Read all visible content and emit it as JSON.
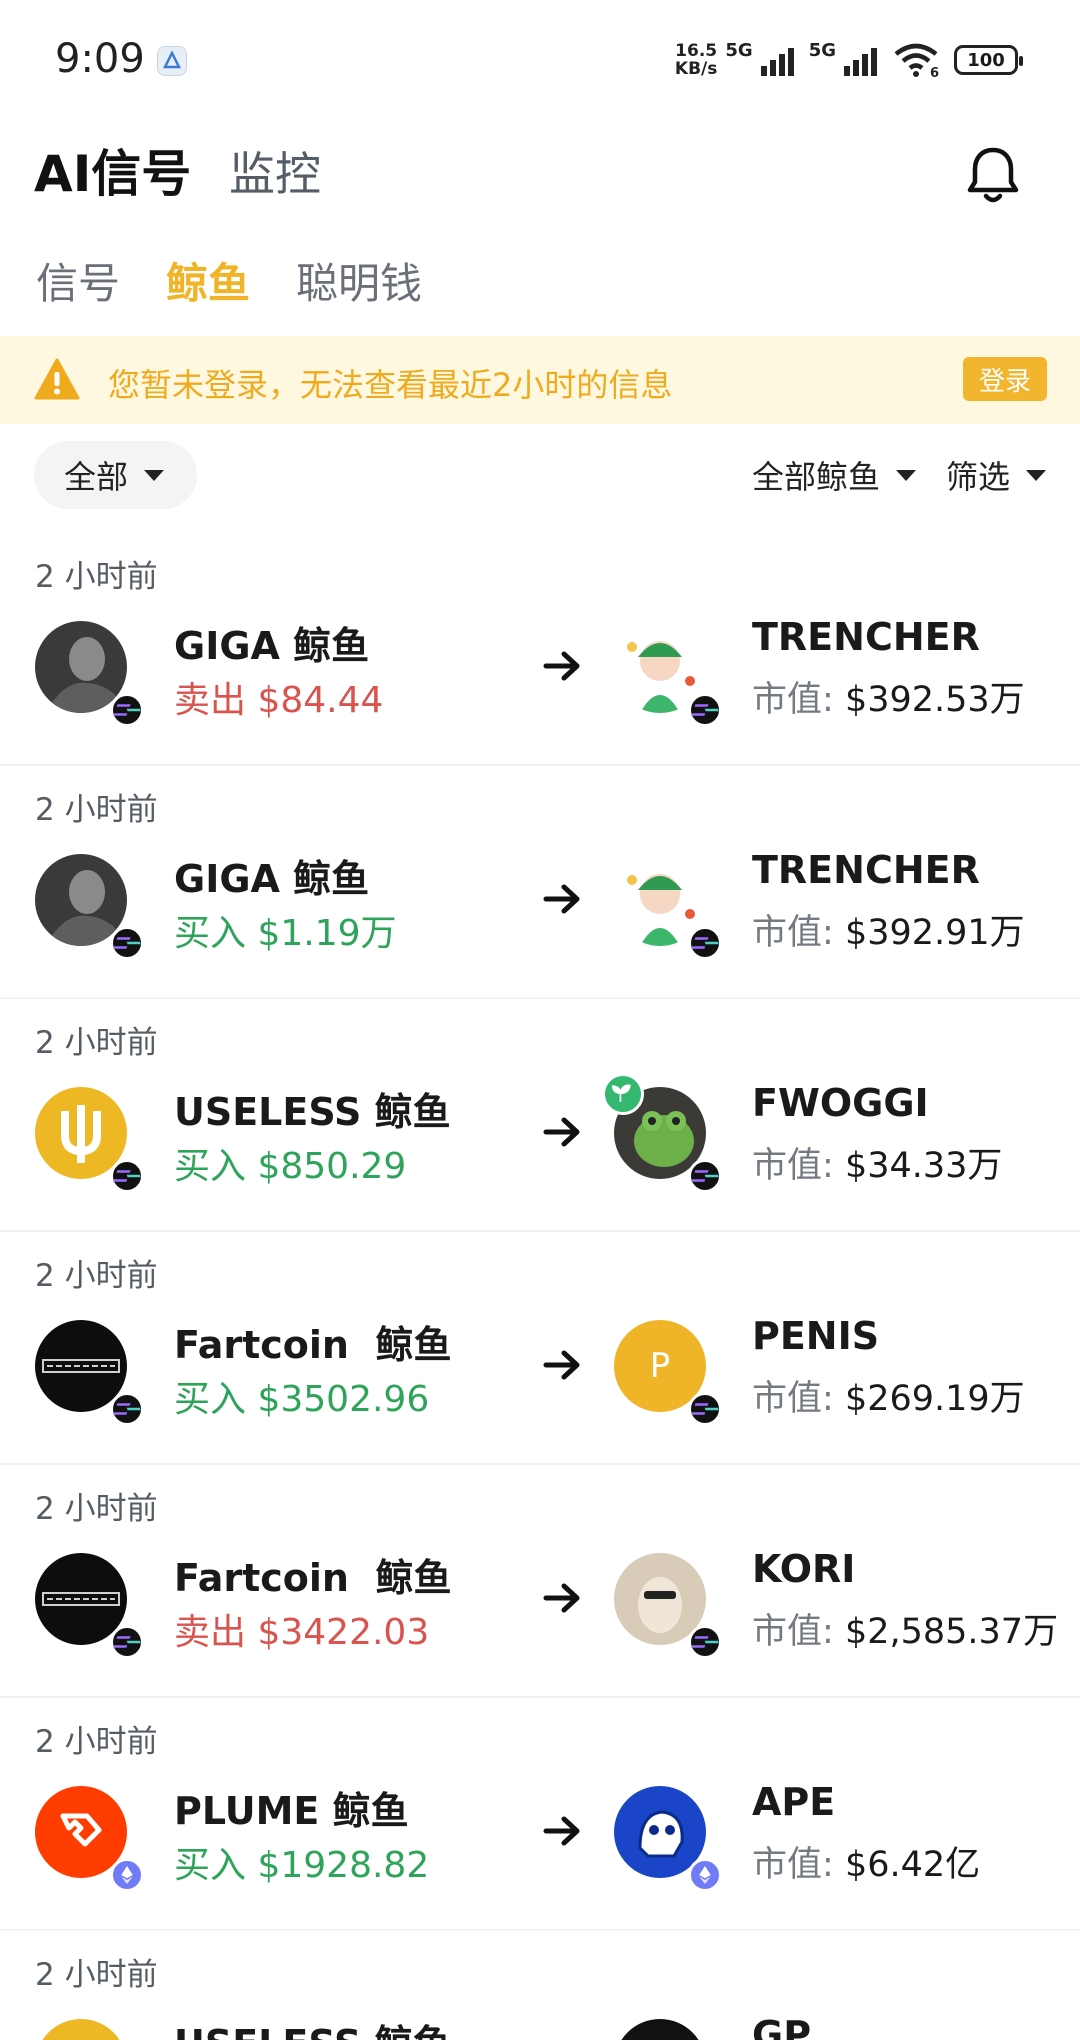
{
  "status_bar": {
    "time": "9:09",
    "speed_value": "16.5",
    "speed_unit": "KB/s",
    "net1": "5G",
    "net2": "5G",
    "wifi_sub": "6",
    "battery": "100"
  },
  "header": {
    "title": "AI信号",
    "secondary": "监控"
  },
  "tabs": [
    {
      "label": "信号",
      "active": false
    },
    {
      "label": "鲸鱼",
      "active": true
    },
    {
      "label": "聪明钱",
      "active": false
    }
  ],
  "banner": {
    "text": "您暂未登录，无法查看最近2小时的信息",
    "button": "登录"
  },
  "filters": {
    "all": "全部",
    "whales": "全部鲸鱼",
    "screen": "筛选"
  },
  "feed": [
    {
      "time": "2 小时前",
      "whale": "GIGA 鲸鱼",
      "side": "卖出",
      "amount": "$84.44",
      "type": "sell",
      "token": "TRENCHER",
      "mcap_label": "市值:",
      "mcap": "$392.53万",
      "chain": "sol"
    },
    {
      "time": "2 小时前",
      "whale": "GIGA 鲸鱼",
      "side": "买入",
      "amount": "$1.19万",
      "type": "buy",
      "token": "TRENCHER",
      "mcap_label": "市值:",
      "mcap": "$392.91万",
      "chain": "sol"
    },
    {
      "time": "2 小时前",
      "whale": "USELESS 鲸鱼",
      "side": "买入",
      "amount": "$850.29",
      "type": "buy",
      "token": "FWOGGI",
      "mcap_label": "市值:",
      "mcap": "$34.33万",
      "chain": "sol"
    },
    {
      "time": "2 小时前",
      "whale": "Fartcoin  鲸鱼",
      "side": "买入",
      "amount": "$3502.96",
      "type": "buy",
      "token": "PENIS",
      "token_letter": "P",
      "mcap_label": "市值:",
      "mcap": "$269.19万",
      "chain": "sol"
    },
    {
      "time": "2 小时前",
      "whale": "Fartcoin  鲸鱼",
      "side": "卖出",
      "amount": "$3422.03",
      "type": "sell",
      "token": "KORI",
      "mcap_label": "市值:",
      "mcap": "$2,585.37万",
      "chain": "sol"
    },
    {
      "time": "2 小时前",
      "whale": "PLUME 鲸鱼",
      "side": "买入",
      "amount": "$1928.82",
      "type": "buy",
      "token": "APE",
      "mcap_label": "市值:",
      "mcap": "$6.42亿",
      "chain": "eth"
    },
    {
      "time": "2 小时前",
      "whale": "USELESS 鲸鱼",
      "token": "GP"
    }
  ],
  "colors": {
    "accent": "#f0b429",
    "sell": "#d9534f",
    "buy": "#2ea45a",
    "banner_bg": "#fff8e1"
  },
  "icons": [
    "notification-bell-icon",
    "warning-icon",
    "arrow-right-icon",
    "solana-chain-icon",
    "ethereum-chain-icon"
  ]
}
